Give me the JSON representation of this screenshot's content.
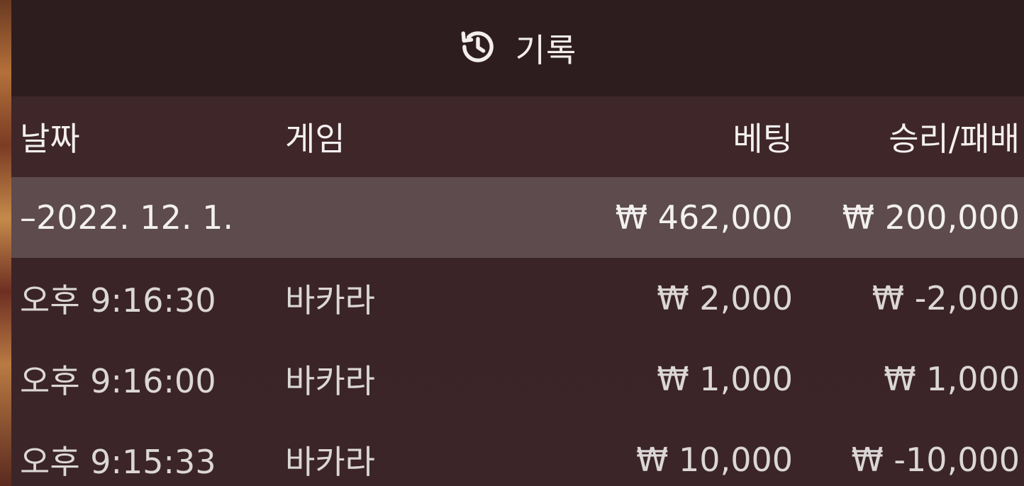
{
  "window": {
    "title": "기록",
    "title_icon": "history-icon"
  },
  "table": {
    "headers": {
      "date": "날짜",
      "game": "게임",
      "bet": "베팅",
      "result": "승리/패배"
    },
    "summary": {
      "date": "–2022. 12. 1.",
      "game": "",
      "bet": "₩ 462,000",
      "result": "₩ 200,000"
    },
    "rows": [
      {
        "date": "오후 9:16:30",
        "game": "바카라",
        "bet": "₩ 2,000",
        "result": "₩ -2,000"
      },
      {
        "date": "오후 9:16:00",
        "game": "바카라",
        "bet": "₩ 1,000",
        "result": "₩ 1,000"
      },
      {
        "date": "오후 9:15:33",
        "game": "바카라",
        "bet": "₩ 10,000",
        "result": "₩ -10,000"
      }
    ]
  },
  "colors": {
    "panel_bg": "#3a2427",
    "title_bg": "#2e1d1f",
    "summary_bg": "#5d4b4d",
    "text": "#e6e1e1"
  }
}
